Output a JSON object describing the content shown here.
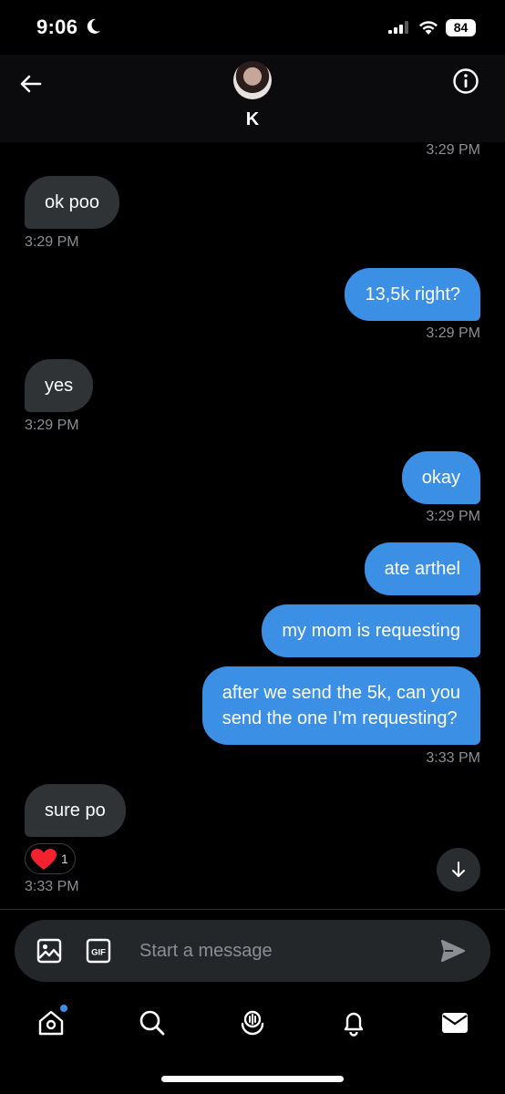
{
  "status_bar": {
    "time": "9:06",
    "battery": "84"
  },
  "header": {
    "contact_name": "K"
  },
  "messages": [
    {
      "type": "timestamp",
      "side": "right",
      "text": "3:29 PM"
    },
    {
      "type": "bubble",
      "side": "in",
      "text": "ok poo",
      "time": "3:29 PM"
    },
    {
      "type": "bubble",
      "side": "out",
      "text": "13,5k right?",
      "time": "3:29 PM"
    },
    {
      "type": "bubble",
      "side": "in",
      "text": "yes",
      "time": "3:29 PM"
    },
    {
      "type": "bubble",
      "side": "out",
      "text": "okay",
      "time": "3:29 PM"
    },
    {
      "type": "bubble",
      "side": "out",
      "text": "ate arthel"
    },
    {
      "type": "bubble",
      "side": "out",
      "text": "my mom is requesting"
    },
    {
      "type": "bubble",
      "side": "out",
      "line1": "after we send the 5k, can you",
      "line2": "send the one I’m requesting?",
      "time": "3:33 PM"
    },
    {
      "type": "bubble",
      "side": "in",
      "text": "sure po",
      "reaction": {
        "icon": "heart-icon",
        "count": "1"
      },
      "time": "3:33 PM"
    }
  ],
  "composer": {
    "placeholder": "Start a message",
    "gif_label": "GIF"
  },
  "nav": [
    "home-icon",
    "search-icon",
    "spaces-icon",
    "notifications-icon",
    "messages-icon"
  ],
  "colors": {
    "accent": "#3b8fe5",
    "incoming_bubble": "#2f3336",
    "reaction_heart": "#f4212e"
  }
}
